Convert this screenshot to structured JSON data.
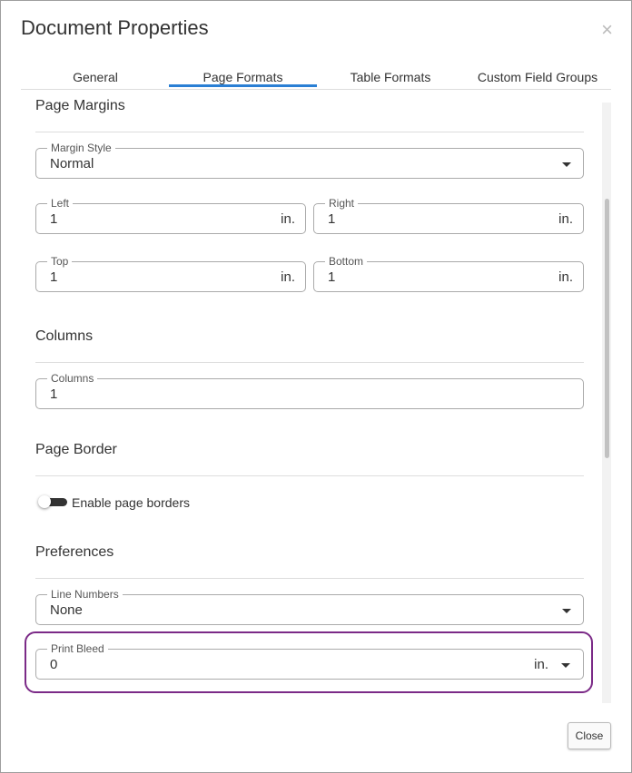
{
  "dialog": {
    "title": "Document Properties",
    "close_icon": "close-icon"
  },
  "tabs": [
    {
      "label": "General"
    },
    {
      "label": "Page Formats"
    },
    {
      "label": "Table Formats"
    },
    {
      "label": "Custom Field Groups"
    }
  ],
  "active_tab": "Page Formats",
  "accent_color": "#2a7fd4",
  "highlight_color": "#7b2a87",
  "page_margins": {
    "title": "Page Margins",
    "margin_style": {
      "label": "Margin Style",
      "value": "Normal"
    },
    "left": {
      "label": "Left",
      "value": "1",
      "unit": "in."
    },
    "right": {
      "label": "Right",
      "value": "1",
      "unit": "in."
    },
    "top": {
      "label": "Top",
      "value": "1",
      "unit": "in."
    },
    "bottom": {
      "label": "Bottom",
      "value": "1",
      "unit": "in."
    }
  },
  "columns": {
    "title": "Columns",
    "field": {
      "label": "Columns",
      "value": "1"
    }
  },
  "page_border": {
    "title": "Page Border",
    "toggle_label": "Enable page borders"
  },
  "preferences": {
    "title": "Preferences",
    "line_numbers": {
      "label": "Line Numbers",
      "value": "None"
    },
    "print_bleed": {
      "label": "Print Bleed",
      "value": "0",
      "unit": "in."
    }
  },
  "footer": {
    "close_label": "Close"
  }
}
